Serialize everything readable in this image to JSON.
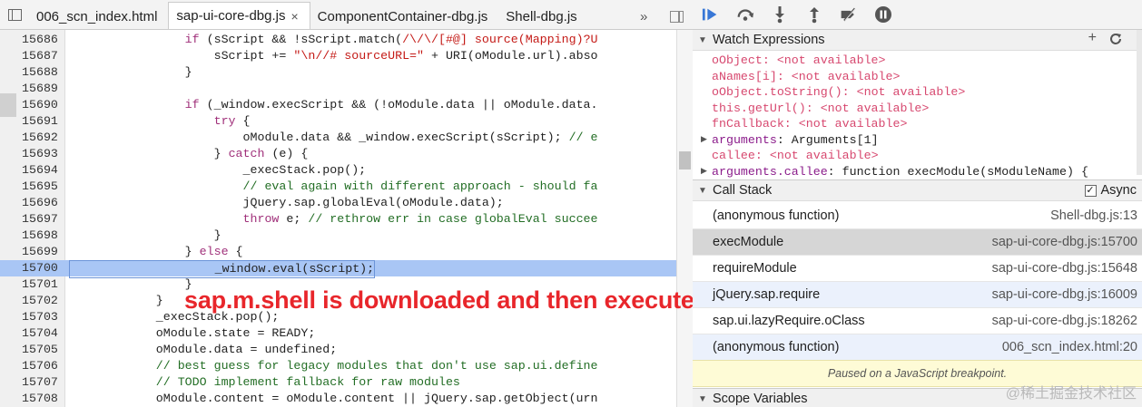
{
  "tabs": [
    {
      "label": "006_scn_index.html",
      "closable": false,
      "active": false
    },
    {
      "label": "sap-ui-core-dbg.js",
      "closable": true,
      "active": true
    },
    {
      "label": "ComponentContainer-dbg.js",
      "closable": false,
      "active": false
    },
    {
      "label": "Shell-dbg.js",
      "closable": false,
      "active": false
    }
  ],
  "tabs_more": "»",
  "close_glyph": "×",
  "code_lines": [
    {
      "num": "15686",
      "code": "                if (sScript && !sScript.match(/\\/\\/[#@] source(Mapping)?U"
    },
    {
      "num": "15687",
      "code": "                    sScript += \"\\n//# sourceURL=\" + URI(oModule.url).abso"
    },
    {
      "num": "15688",
      "code": "                }"
    },
    {
      "num": "15689",
      "code": ""
    },
    {
      "num": "15690",
      "code": "                if (_window.execScript && (!oModule.data || oModule.data."
    },
    {
      "num": "15691",
      "code": "                    try {"
    },
    {
      "num": "15692",
      "code": "                        oModule.data && _window.execScript(sScript); // e"
    },
    {
      "num": "15693",
      "code": "                    } catch (e) {"
    },
    {
      "num": "15694",
      "code": "                        _execStack.pop();"
    },
    {
      "num": "15695",
      "code": "                        // eval again with different approach - should fa"
    },
    {
      "num": "15696",
      "code": "                        jQuery.sap.globalEval(oModule.data);"
    },
    {
      "num": "15697",
      "code": "                        throw e; // rethrow err in case globalEval succee"
    },
    {
      "num": "15698",
      "code": "                    }"
    },
    {
      "num": "15699",
      "code": "                } else {"
    },
    {
      "num": "15700",
      "code": "                    _window.eval(sScript);",
      "highlight": true
    },
    {
      "num": "15701",
      "code": "                }"
    },
    {
      "num": "15702",
      "code": "            }"
    },
    {
      "num": "15703",
      "code": "            _execStack.pop();"
    },
    {
      "num": "15704",
      "code": "            oModule.state = READY;"
    },
    {
      "num": "15705",
      "code": "            oModule.data = undefined;"
    },
    {
      "num": "15706",
      "code": "            // best guess for legacy modules that don't use sap.ui.define"
    },
    {
      "num": "15707",
      "code": "            // TODO implement fallback for raw modules"
    },
    {
      "num": "15708",
      "code": "            oModule.content = oModule.content || jQuery.sap.getObject(urn"
    }
  ],
  "overlay_text": "sap.m.shell is downloaded and then executed",
  "debugger_toolbar": [
    "resume-icon",
    "step-over-icon",
    "step-into-icon",
    "step-out-icon",
    "deactivate-breakpoints-icon",
    "pause-on-exceptions-icon"
  ],
  "watch": {
    "title": "Watch Expressions",
    "add_glyph": "+",
    "refresh_glyph": "C",
    "items": [
      {
        "name": "oObject",
        "value": "<not available>",
        "available": false
      },
      {
        "name": "aNames[i]",
        "value": "<not available>",
        "available": false
      },
      {
        "name": "oObject.toString()",
        "value": "<not available>",
        "available": false
      },
      {
        "name": "this.getUrl()",
        "value": "<not available>",
        "available": false
      },
      {
        "name": "fnCallback",
        "value": "<not available>",
        "available": false
      },
      {
        "name": "arguments",
        "value": "Arguments[1]",
        "available": true,
        "expandable": true
      },
      {
        "name": "callee",
        "value": "<not available>",
        "available": false
      },
      {
        "name": "arguments.callee",
        "value": "function execModule(sModuleName) {",
        "available": true,
        "expandable": true
      }
    ]
  },
  "call_stack": {
    "title": "Call Stack",
    "async_label": "Async",
    "async_checked": true,
    "frames": [
      {
        "fn": "(anonymous function)",
        "loc": "Shell-dbg.js:13",
        "style": "normal"
      },
      {
        "fn": "execModule",
        "loc": "sap-ui-core-dbg.js:15700",
        "style": "selected"
      },
      {
        "fn": "requireModule",
        "loc": "sap-ui-core-dbg.js:15648",
        "style": "normal"
      },
      {
        "fn": "jQuery.sap.require",
        "loc": "sap-ui-core-dbg.js:16009",
        "style": "blue"
      },
      {
        "fn": "sap.ui.lazyRequire.oClass",
        "loc": "sap-ui-core-dbg.js:18262",
        "style": "normal"
      },
      {
        "fn": "(anonymous function)",
        "loc": "006_scn_index.html:20",
        "style": "blue"
      }
    ]
  },
  "paused_message": "Paused on a JavaScript breakpoint.",
  "scope": {
    "title": "Scope Variables"
  },
  "watermark": "@稀土掘金技术社区"
}
